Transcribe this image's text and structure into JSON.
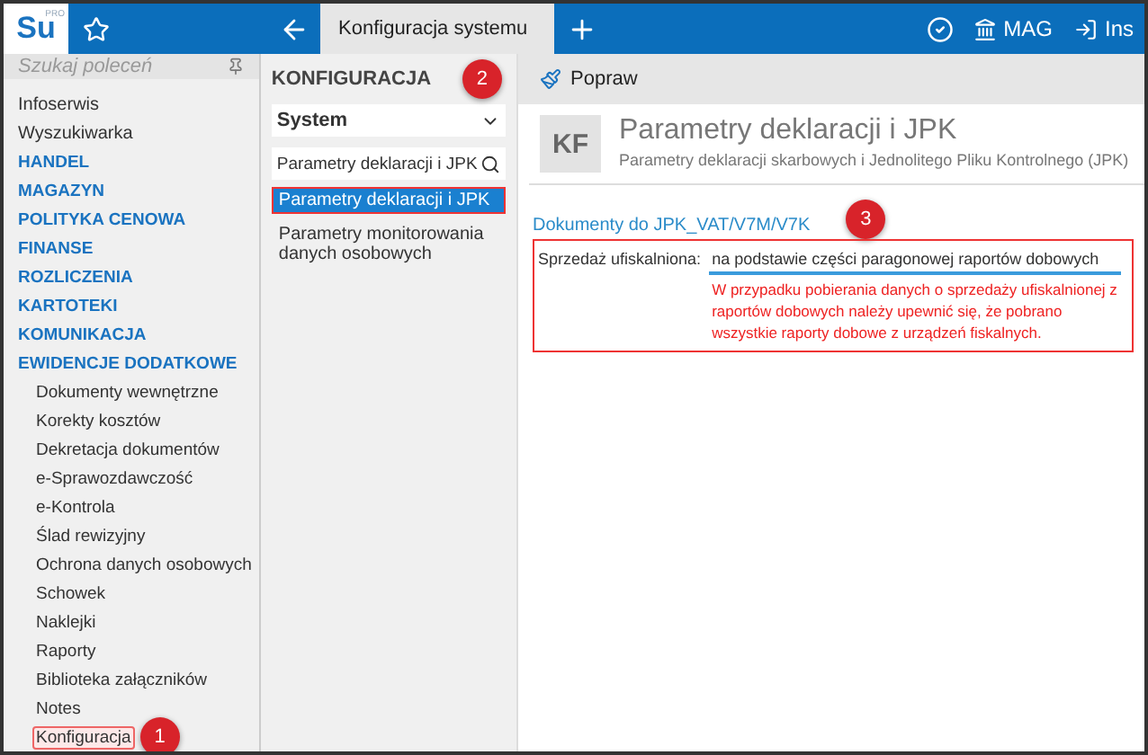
{
  "app": {
    "logo": "Su",
    "logo_badge": "PRO"
  },
  "tabs": [
    {
      "label": "Konfiguracja systemu",
      "selected": true
    }
  ],
  "top_right": [
    {
      "label": "MAG",
      "kind": "warehouse"
    },
    {
      "label": "Ins",
      "kind": "login"
    }
  ],
  "sidebar": {
    "search_placeholder": "Szukaj poleceń",
    "items": [
      {
        "label": "Infoserwis",
        "kind": "link"
      },
      {
        "label": "Wyszukiwarka",
        "kind": "link"
      },
      {
        "label": "HANDEL",
        "kind": "section"
      },
      {
        "label": "MAGAZYN",
        "kind": "section"
      },
      {
        "label": "POLITYKA CENOWA",
        "kind": "section"
      },
      {
        "label": "FINANSE",
        "kind": "section"
      },
      {
        "label": "ROZLICZENIA",
        "kind": "section"
      },
      {
        "label": "KARTOTEKI",
        "kind": "section"
      },
      {
        "label": "KOMUNIKACJA",
        "kind": "section"
      },
      {
        "label": "EWIDENCJE DODATKOWE",
        "kind": "section",
        "children": [
          {
            "label": "Dokumenty wewnętrzne",
            "marked": false
          },
          {
            "label": "Korekty kosztów",
            "marked": false
          },
          {
            "label": "Dekretacja dokumentów",
            "marked": false
          },
          {
            "label": "e-Sprawozdawczość",
            "marked": false
          },
          {
            "label": "e-Kontrola",
            "marked": false
          },
          {
            "label": "Ślad rewizyjny",
            "marked": false
          },
          {
            "label": "Ochrona danych osobowych",
            "marked": false
          },
          {
            "label": "Schowek",
            "marked": false
          },
          {
            "label": "Naklejki",
            "marked": false
          },
          {
            "label": "Raporty",
            "marked": false
          },
          {
            "label": "Biblioteka załączników",
            "marked": false
          },
          {
            "label": "Notes",
            "marked": false
          },
          {
            "label": "Konfiguracja",
            "marked": true,
            "callout": "1"
          }
        ]
      }
    ]
  },
  "middle": {
    "title": "KONFIGURACJA",
    "select": "System",
    "search_value": "Parametry deklaracji i JPK",
    "search_callout": "2",
    "items": [
      {
        "label": "Parametry deklaracji i JPK",
        "selected": true,
        "marked": true
      },
      {
        "label": "Parametry monitorowania danych osobowych",
        "selected": false,
        "marked": false
      }
    ]
  },
  "main": {
    "toolbar": [
      {
        "label": "Popraw"
      }
    ],
    "header": {
      "badge": "KF",
      "title": "Parametry deklaracji i JPK",
      "subtitle": "Parametry deklaracji skarbowych i Jednolitego Pliku Kontrolnego (JPK)"
    },
    "section_link": "Dokumenty do JPK_VAT/V7M/V7K",
    "section_callout": "3",
    "field": {
      "label": "Sprzedaż ufiskalniona:",
      "value": "na podstawie części paragonowej raportów dobowych",
      "warning": "W przypadku pobierania danych o sprzedaży ufiskalnionej z raportów dobowych należy upewnić się, że pobrano wszystkie raporty dobowe z urządzeń fiskalnych.",
      "marked": true
    }
  }
}
